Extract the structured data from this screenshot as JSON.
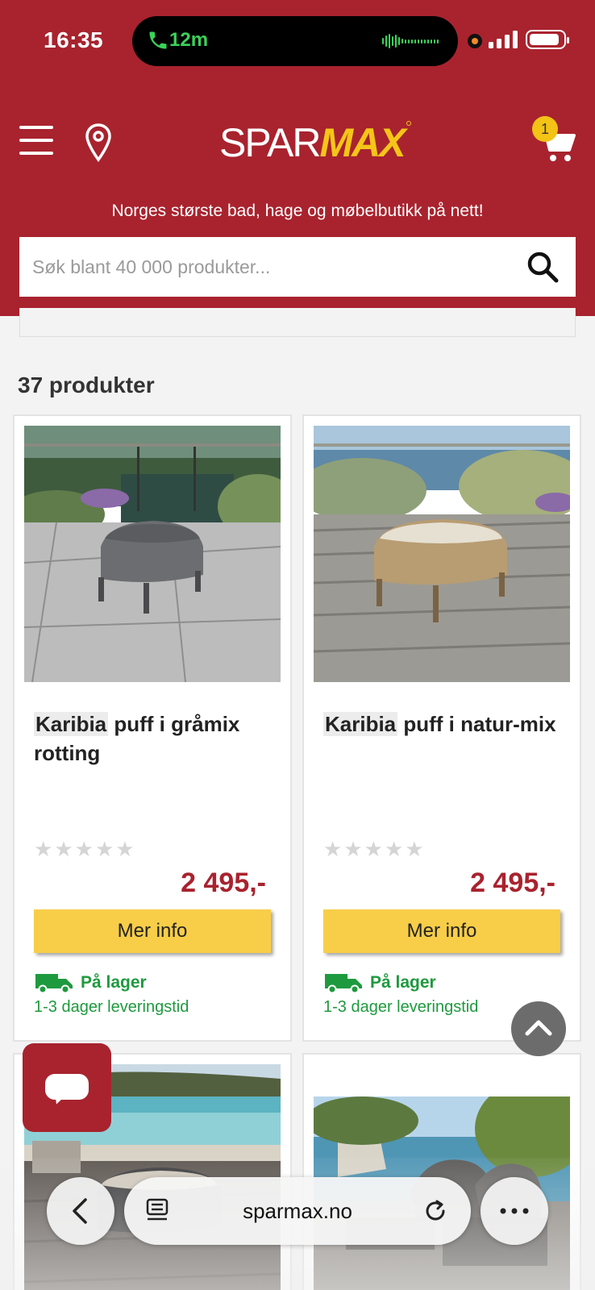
{
  "status_bar": {
    "time": "16:35",
    "call_duration": "12m"
  },
  "header": {
    "logo_part1": "SPAR",
    "logo_part2": "MAX",
    "cart_count": "1",
    "tagline": "Norges største bad, hage og møbelbutikk på nett!",
    "search_placeholder": "Søk blant 40 000 produkter..."
  },
  "listing": {
    "count_label": "37 produkter"
  },
  "products": [
    {
      "brand": "Karibia",
      "name": " puff i gråmix rotting",
      "price": "2 495,-",
      "button_label": "Mer info",
      "stock_label": "På lager",
      "delivery_label": "1-3 dager leveringstid",
      "rating": 0
    },
    {
      "brand": "Karibia",
      "name": " puff i natur-mix",
      "price": "2 495,-",
      "button_label": "Mer info",
      "stock_label": "På lager",
      "delivery_label": "1-3 dager leveringstid",
      "rating": 0
    }
  ],
  "browser": {
    "url": "sparmax.no"
  },
  "colors": {
    "brand_red": "#a8232e",
    "logo_yellow": "#f5c518",
    "button_yellow": "#f8cd48",
    "stock_green": "#1e9a3e"
  }
}
